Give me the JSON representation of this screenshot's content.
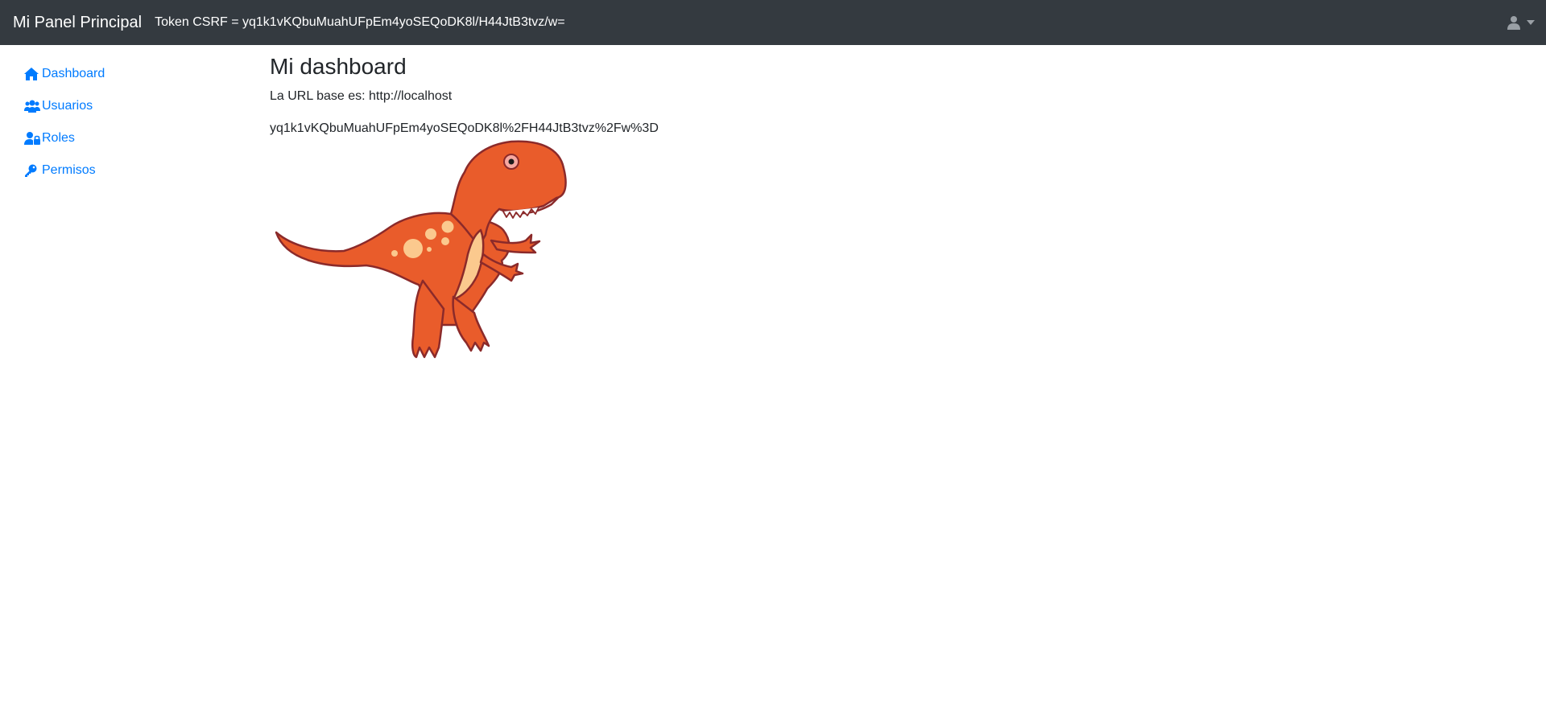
{
  "navbar": {
    "brand": "Mi Panel Principal",
    "csrf_text": "Token CSRF = yq1k1vKQbuMuahUFpEm4yoSEQoDK8l/H44JtB3tvz/w=",
    "user_icon": "user-icon",
    "dropdown_icon": "caret-down-icon"
  },
  "sidebar": {
    "items": [
      {
        "label": "Dashboard",
        "icon": "home-icon"
      },
      {
        "label": "Usuarios",
        "icon": "users-icon"
      },
      {
        "label": "Roles",
        "icon": "user-lock-icon"
      },
      {
        "label": "Permisos",
        "icon": "key-icon"
      }
    ]
  },
  "main": {
    "title": "Mi dashboard",
    "url_text": "La URL base es: http://localhost",
    "token_encoded": "yq1k1vKQbuMuahUFpEm4yoSEQoDK8l%2FH44JtB3tvz%2Fw%3D",
    "image": "t-rex-dinosaur-illustration"
  },
  "colors": {
    "navbar_bg": "#343a40",
    "link": "#007bff",
    "dino_body": "#e95c2b",
    "dino_belly": "#fbc98e",
    "dino_outline": "#8b2a2a"
  }
}
